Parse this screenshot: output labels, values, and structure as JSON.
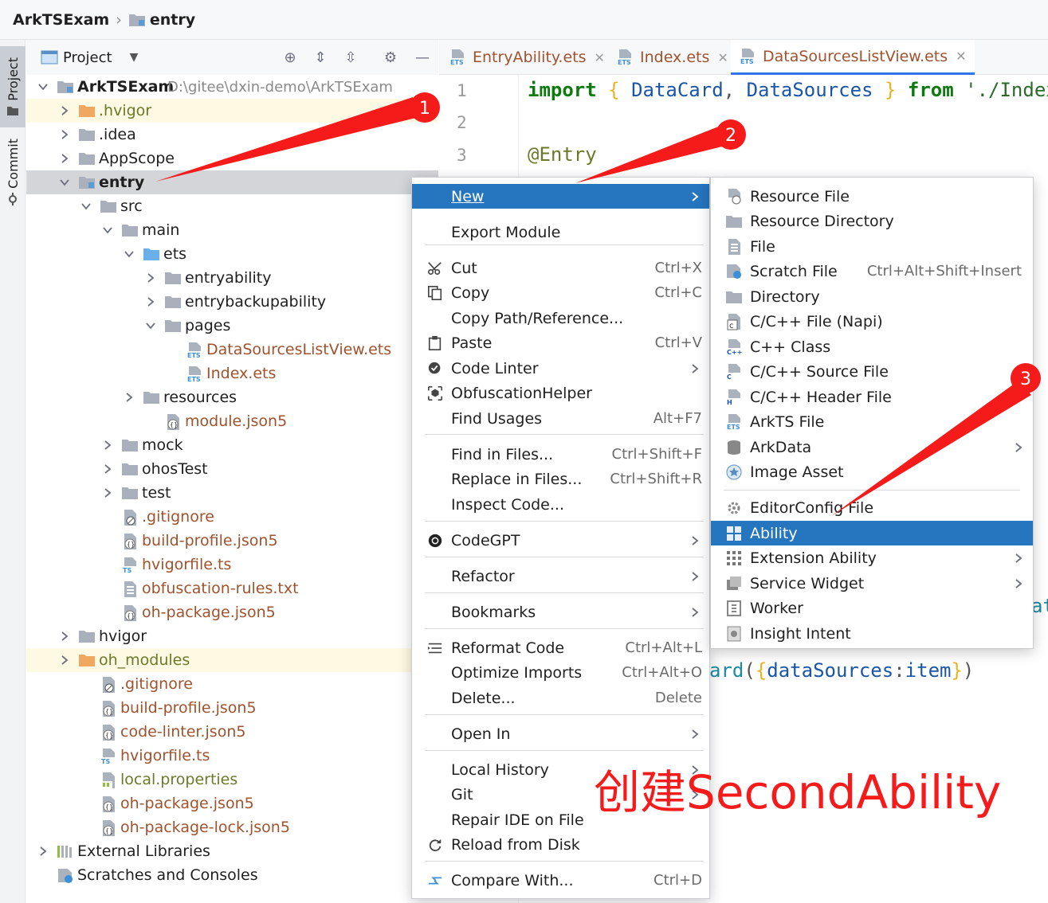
{
  "breadcrumb": {
    "project": "ArkTSExam",
    "module": "entry"
  },
  "toolwindows": {
    "project": "Project",
    "commit": "Commit"
  },
  "project_panel": {
    "title": "Project"
  },
  "tree": {
    "root_name": "ArkTSExam",
    "root_path": "D:\\gitee\\dxin-demo\\ArkTSExam",
    "hvigor_dir": ".hvigor",
    "idea": ".idea",
    "appscope": "AppScope",
    "entry": "entry",
    "src": "src",
    "main": "main",
    "ets": "ets",
    "entryability": "entryability",
    "entrybackupability": "entrybackupability",
    "pages": "pages",
    "file_dslv": "DataSourcesListView.ets",
    "file_index": "Index.ets",
    "resources": "resources",
    "module_json": "module.json5",
    "mock": "mock",
    "ohostest": "ohosTest",
    "test": "test",
    "entry_gitignore": ".gitignore",
    "entry_build_profile": "build-profile.json5",
    "entry_hvigorfile": "hvigorfile.ts",
    "obfuscation": "obfuscation-rules.txt",
    "entry_oh_package": "oh-package.json5",
    "hvigor": "hvigor",
    "oh_modules": "oh_modules",
    "gitignore": ".gitignore",
    "build_profile": "build-profile.json5",
    "code_linter": "code-linter.json5",
    "hvigorfile": "hvigorfile.ts",
    "local_properties": "local.properties",
    "oh_package": "oh-package.json5",
    "oh_package_lock": "oh-package-lock.json5",
    "external_libraries": "External Libraries",
    "scratches": "Scratches and Consoles"
  },
  "editor": {
    "tabs": [
      {
        "label": "EntryAbility.ets"
      },
      {
        "label": "Index.ets"
      },
      {
        "label": "DataSourcesListView.ets"
      }
    ],
    "line_numbers": [
      "1",
      "2",
      "3"
    ],
    "code": {
      "import_kw": "import",
      "brace_open": "{",
      "datacard": "DataCard",
      "comma": ",",
      "datasources": "DataSources",
      "brace_close": "}",
      "from_kw": "from",
      "path_str": "'./Index'",
      "entry_decorator": "@Entry",
      "frag_at": "at",
      "frag_card": "ard",
      "paren_open": "(",
      "ds_prop": "dataSources",
      "colon": ":",
      "item": "item",
      "paren_close": ")"
    }
  },
  "context_menu": {
    "new": "New",
    "export_module": "Export Module",
    "cut": "Cut",
    "cut_sc": "Ctrl+X",
    "copy": "Copy",
    "copy_sc": "Ctrl+C",
    "copy_path": "Copy Path/Reference...",
    "paste": "Paste",
    "paste_sc": "Ctrl+V",
    "code_linter": "Code Linter",
    "obfuscation_helper": "ObfuscationHelper",
    "find_usages": "Find Usages",
    "find_usages_sc": "Alt+F7",
    "find_in_files": "Find in Files...",
    "find_in_files_sc": "Ctrl+Shift+F",
    "replace_in_files": "Replace in Files...",
    "replace_in_files_sc": "Ctrl+Shift+R",
    "inspect_code": "Inspect Code...",
    "codegpt": "CodeGPT",
    "refactor": "Refactor",
    "bookmarks": "Bookmarks",
    "reformat": "Reformat Code",
    "reformat_sc": "Ctrl+Alt+L",
    "optimize": "Optimize Imports",
    "optimize_sc": "Ctrl+Alt+O",
    "delete": "Delete...",
    "delete_sc": "Delete",
    "open_in": "Open In",
    "local_history": "Local History",
    "git": "Git",
    "repair_ide": "Repair IDE on File",
    "reload": "Reload from Disk",
    "compare": "Compare With...",
    "compare_sc": "Ctrl+D"
  },
  "submenu": {
    "resource_file": "Resource File",
    "resource_directory": "Resource Directory",
    "file": "File",
    "scratch_file": "Scratch File",
    "scratch_file_sc": "Ctrl+Alt+Shift+Insert",
    "directory": "Directory",
    "cpp_file_napi": "C/C++ File (Napi)",
    "cpp_class": "C++ Class",
    "cpp_source": "C/C++ Source File",
    "cpp_header": "C/C++ Header File",
    "arkts_file": "ArkTS File",
    "arkdata": "ArkData",
    "image_asset": "Image Asset",
    "editorconfig": "EditorConfig File",
    "ability": "Ability",
    "extension_ability": "Extension Ability",
    "service_widget": "Service Widget",
    "worker": "Worker",
    "insight_intent": "Insight Intent"
  },
  "annotations": {
    "markers": [
      "1",
      "2",
      "3"
    ],
    "caption": "创建SecondAbility"
  },
  "colors": {
    "selection": "#2675bf",
    "annotation_red": "#f51b1b",
    "folder": "#a9b0bc",
    "excluded_folder": "#f0a75f",
    "source_folder": "#6ab0e8",
    "file_brown": "#a0522d"
  }
}
